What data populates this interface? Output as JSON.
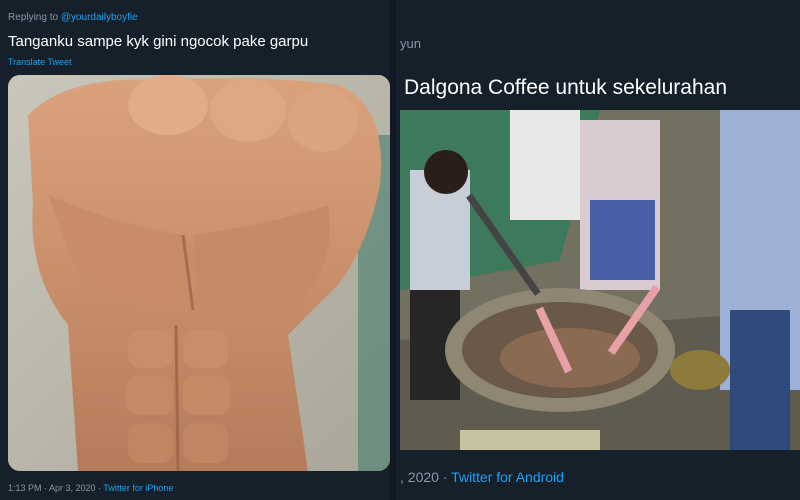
{
  "left_tweet": {
    "replying_prefix": "Replying to ",
    "replying_handle": "@yourdailyboyfie",
    "text": "Tanganku sampe kyk gini ngocok pake garpu",
    "translate_label": "Translate Tweet",
    "image_icon": "image-photo",
    "timestamp": "1:13 PM · Apr 3, 2020 · ",
    "source": "Twitter for iPhone"
  },
  "right_tweet": {
    "name_fragment": "yun",
    "text": "Dalgona Coffee untuk sekelurahan",
    "image_icon": "image-photo",
    "timestamp": ", 2020 · ",
    "source": "Twitter for Android"
  },
  "colors": {
    "background": "#15202b",
    "text": "#ffffff",
    "muted": "#8899a6",
    "link": "#1da1f2"
  }
}
